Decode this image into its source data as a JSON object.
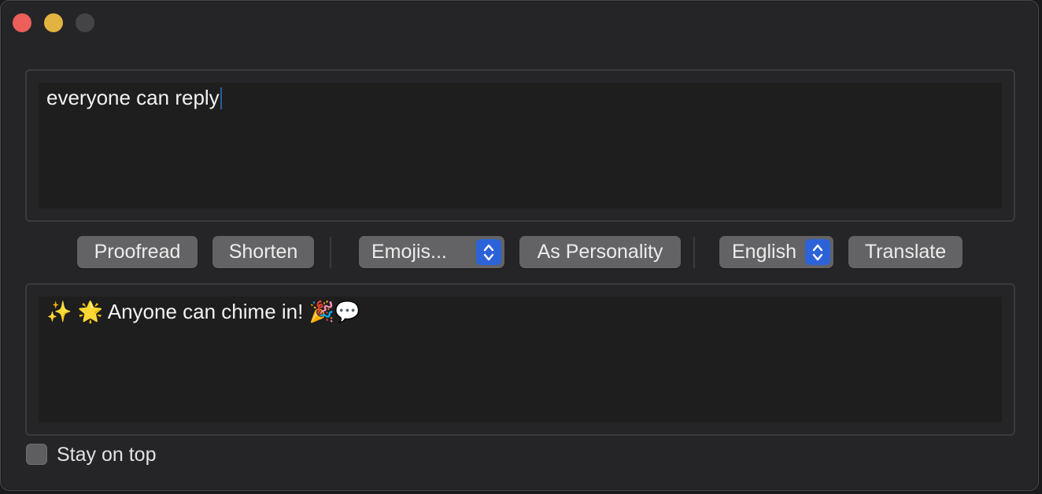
{
  "input": {
    "text": "everyone can reply"
  },
  "toolbar": {
    "proofread": "Proofread",
    "shorten": "Shorten",
    "style_select": "Emojis...",
    "as_personality": "As Personality",
    "language_select": "English",
    "translate": "Translate"
  },
  "output": {
    "text": "✨ 🌟 Anyone can chime in! 🎉💬"
  },
  "stay_on_top": {
    "label": "Stay on top",
    "checked": false
  },
  "colors": {
    "accent": "#2d63d8",
    "close": "#ec5f5a",
    "minimize": "#e3b341"
  }
}
